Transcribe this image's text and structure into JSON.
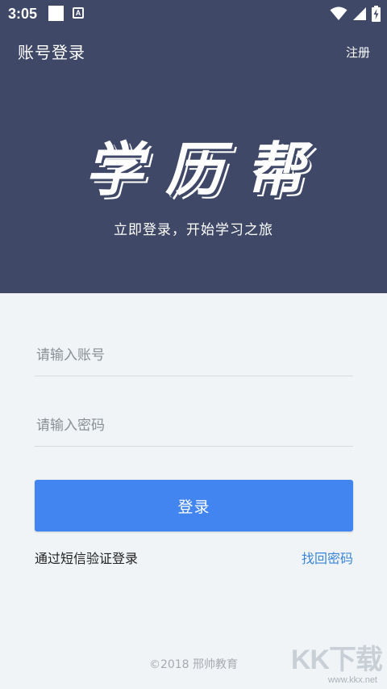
{
  "status_bar": {
    "time": "3:05",
    "notification_badge_letter": "A",
    "icons": [
      "white-square-icon",
      "a-notification-icon",
      "wifi-icon",
      "signal-icon",
      "battery-charging-icon"
    ]
  },
  "header": {
    "title": "账号登录",
    "register_label": "注册"
  },
  "brand": {
    "logo_text": [
      "学",
      "历",
      "帮"
    ],
    "tagline": "立即登录，开始学习之旅"
  },
  "form": {
    "account_placeholder": "请输入账号",
    "account_value": "",
    "password_placeholder": "请输入密码",
    "password_value": "",
    "login_label": "登录",
    "sms_login_label": "通过短信验证登录",
    "forgot_password_label": "找回密码"
  },
  "footer": {
    "copyright": "©2018 邢帅教育"
  },
  "watermark": {
    "main": "KK下载",
    "sub": "www.kkx.net"
  },
  "colors": {
    "header_background": "#3f4866",
    "page_background": "#f0f4f6",
    "primary_button": "#4285f0",
    "link": "#3b86d8"
  }
}
